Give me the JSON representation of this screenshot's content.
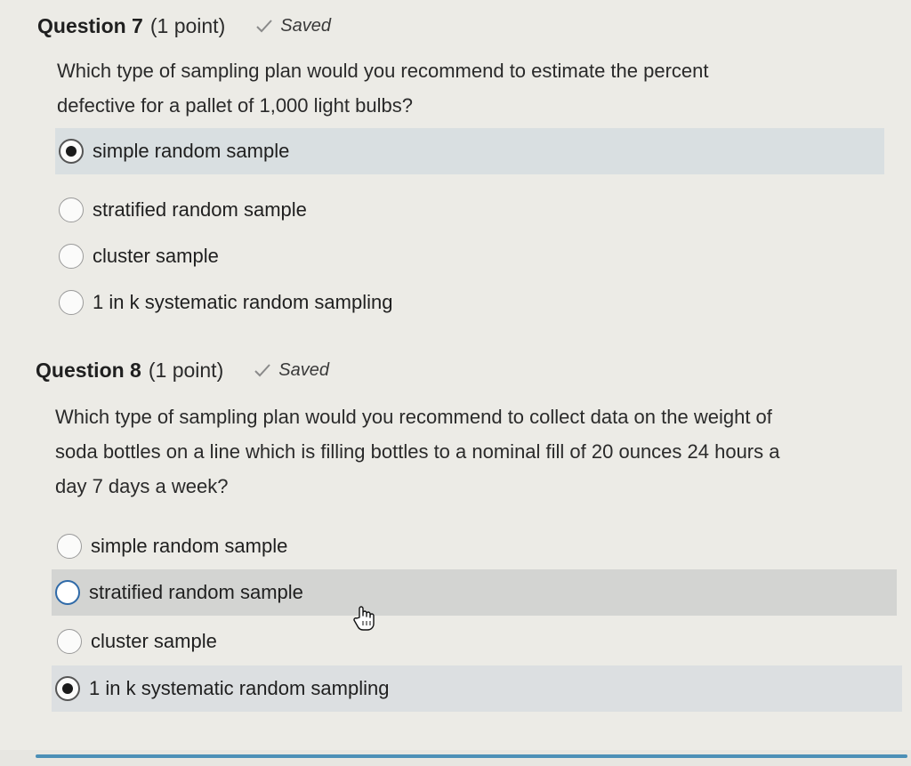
{
  "questions": [
    {
      "title": "Question 7",
      "points": "(1 point)",
      "status": "Saved",
      "text_lines": [
        "Which type of sampling plan would you recommend to estimate the percent",
        "defective for a pallet of 1,000 light bulbs?"
      ],
      "options": [
        {
          "label": "simple random sample",
          "selected": true
        },
        {
          "label": "stratified random sample",
          "selected": false
        },
        {
          "label": "cluster sample",
          "selected": false
        },
        {
          "label": "1 in k systematic random sampling",
          "selected": false
        }
      ]
    },
    {
      "title": "Question 8",
      "points": "(1 point)",
      "status": "Saved",
      "text_lines": [
        "Which type of sampling plan would you recommend to collect data on the weight of",
        "soda bottles on a line which is filling bottles to a nominal fill of 20 ounces 24 hours a",
        "day 7 days a week?"
      ],
      "options": [
        {
          "label": "simple random sample",
          "selected": false
        },
        {
          "label": "stratified random sample",
          "selected": false
        },
        {
          "label": "cluster sample",
          "selected": false
        },
        {
          "label": "1 in k systematic random sampling",
          "selected": true
        }
      ]
    }
  ],
  "icons": {
    "check": "checkmark-icon",
    "cursor": "hand-pointer-icon"
  },
  "colors": {
    "background": "#ecebe6",
    "selected_highlight": "#d9dfe1",
    "hover_highlight": "#d3d4d2",
    "focus_ring": "#2f6aa8"
  }
}
